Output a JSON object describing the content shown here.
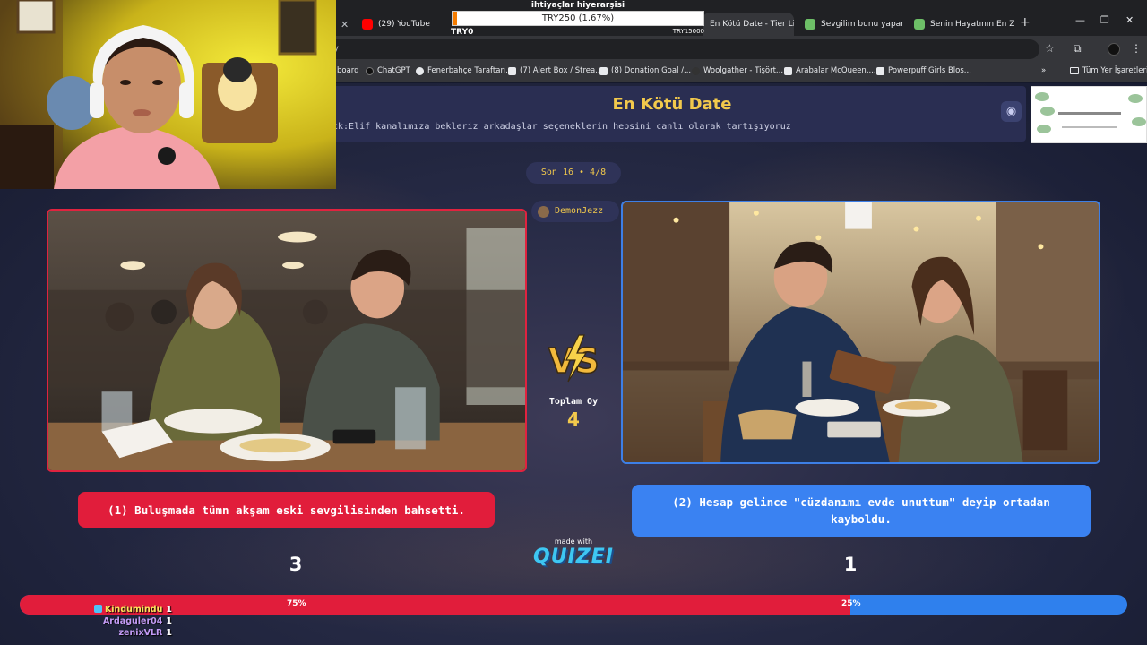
{
  "browser": {
    "tabs": [
      {
        "title": "(29) YouTube",
        "favicon_color": "#ff0000"
      },
      {
        "title": "En Kötü Date - Tier Li",
        "favicon_color": "#9aa0a6"
      },
      {
        "title": "Sevgilim bunu yapar",
        "favicon_color": "#6dbf67"
      },
      {
        "title": "Senin Hayatının En Zo",
        "favicon_color": "#6dbf67"
      }
    ],
    "omnibox_text": "y",
    "bookmarks": [
      {
        "label": "board"
      },
      {
        "label": "ChatGPT"
      },
      {
        "label": "Fenerbahçe Taraftarı..."
      },
      {
        "label": "(7) Alert Box / Strea..."
      },
      {
        "label": "(8) Donation Goal /..."
      },
      {
        "label": "Woolgather - Tişört..."
      },
      {
        "label": "Arabalar McQueen,..."
      },
      {
        "label": "Powerpuff Girls Blos..."
      }
    ],
    "bookmarks_more": "»",
    "all_bookmarks": "Tüm Yer İşaretleri"
  },
  "donation_goal": {
    "title": "ihtiyaçlar hiyerarşisi",
    "progress_text": "TRY250 (1.67%)",
    "progress_fraction": 0.0167,
    "min_label": "TRY0",
    "max_label": "TRY15000",
    "fill_color": "#f57c00"
  },
  "quiz": {
    "title": "En Kötü Date",
    "description": "ck:Elif kanalımıza bekleriz arkadaşlar seçeneklerin hepsini canlı olarak tartışıyoruz",
    "round_label": "Son 16 • 4/8",
    "username": "DemonJezz",
    "total_votes_label": "Toplam Oy",
    "total_votes": "4",
    "option_left": {
      "text": "(1) Buluşmada tümn akşam eski sevgilisinden bahsetti.",
      "votes": "3",
      "percent_label": "75%",
      "percent": 75,
      "color": "#e11d3b"
    },
    "option_right": {
      "text": "(2) Hesap gelince \"cüzdanımı evde unuttum\" deyip ortadan kayboldu.",
      "votes": "1",
      "percent_label": "25%",
      "percent": 25,
      "color": "#2f80ed"
    },
    "made_with": "made with",
    "logo_text": "QUIZEI",
    "accent_color": "#f2c94c"
  },
  "chat": [
    {
      "name": "Kindumindu",
      "value": "1",
      "color": "#ffe45c",
      "badge": true
    },
    {
      "name": "Ardaguler04",
      "value": "1",
      "color": "#c39bf5",
      "badge": false
    },
    {
      "name": "zenixVLR",
      "value": "1",
      "color": "#c39bf5",
      "badge": false
    }
  ]
}
